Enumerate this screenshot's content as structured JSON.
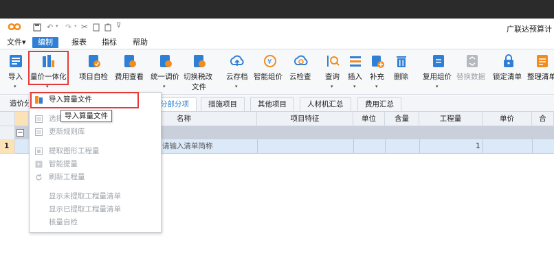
{
  "app": {
    "title": "广联达预算计"
  },
  "quick_toolbar": {
    "undo_icon": "undo-icon",
    "redo_icon": "redo-icon",
    "cut_icon": "cut-icon",
    "copy_icon": "copy-icon",
    "paste_icon": "paste-icon",
    "more_icon": "quick-more-icon"
  },
  "menu": {
    "file": "文件▾",
    "edit": "编制",
    "report": "报表",
    "index": "指标",
    "help": "帮助"
  },
  "ribbon": {
    "import": "导入",
    "quantity_price": "量价一体化",
    "self_check": "项目自检",
    "fee_view": "费用查看",
    "unify_price": "统一调价",
    "switch_tax": "切换税改",
    "switch_tax_2": "文件",
    "cloud_save": "云存档",
    "smart_price": "智能组价",
    "cloud_check": "云检查",
    "query": "查询",
    "insert": "插入",
    "supplement": "补充",
    "delete": "删除",
    "reuse_price": "复用组价",
    "replace_data": "替换数据",
    "lock_list": "锁定清单",
    "arrange_list": "整理清单"
  },
  "tabs": {
    "cost_analysis": "造价分",
    "sub_items": "分部分项",
    "measures": "措施项目",
    "other": "其他项目",
    "labor_material": "人材机汇总",
    "fee_summary": "费用汇总"
  },
  "grid": {
    "headers": {
      "name": "名称",
      "feature": "项目特征",
      "unit": "单位",
      "content": "含量",
      "quantity": "工程量",
      "price": "单价",
      "combined": "合"
    },
    "row_number": "1",
    "row_placeholder": "请输入清单简称",
    "row_quantity": "1",
    "collapse": "−"
  },
  "dropdown": {
    "items": [
      {
        "label": "导入算量文件"
      },
      {
        "label": "选择"
      },
      {
        "label": "更新规则库"
      },
      {
        "label": "提取图形工程量"
      },
      {
        "label": "智能提量"
      },
      {
        "label": "刷新工程量"
      },
      {
        "label": "显示未提取工程量清单"
      },
      {
        "label": "显示已提取工程量清单"
      },
      {
        "label": "核量自检"
      }
    ]
  },
  "tooltip": {
    "text": "导入算量文件"
  },
  "colors": {
    "accent": "#2f7fd6",
    "highlight_red": "#e53935",
    "topbar": "#2b2b2b",
    "logo": "#f28c1a"
  }
}
